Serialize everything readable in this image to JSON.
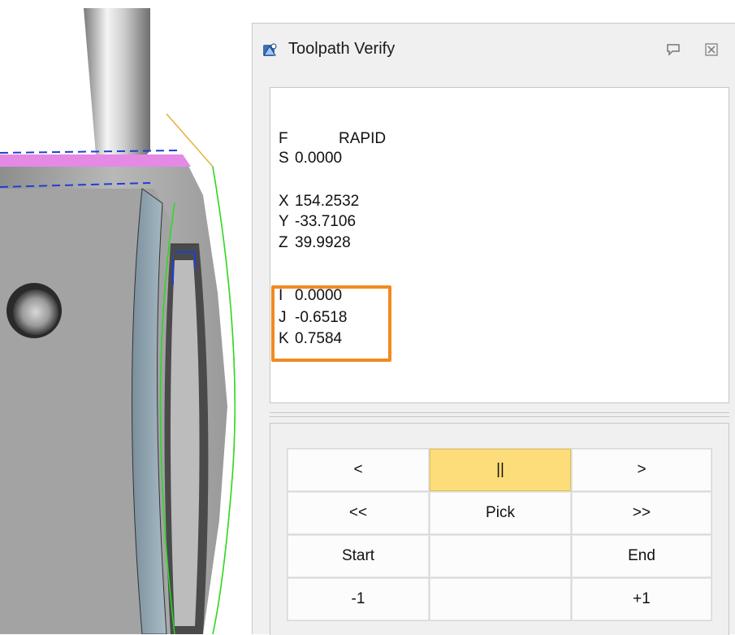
{
  "window": {
    "title": "Toolpath Verify"
  },
  "info": {
    "f_label": "F",
    "f_value": "RAPID",
    "s_label": "S",
    "s_value": "0.0000",
    "x_label": "X",
    "x_value": "154.2532",
    "y_label": "Y",
    "y_value": "-33.7106",
    "z_label": "Z",
    "z_value": "39.9928",
    "i_label": "I",
    "i_value": "0.0000",
    "j_label": "J",
    "j_value": "-0.6518",
    "k_label": "K",
    "k_value": "0.7584"
  },
  "buttons": {
    "prev": "<",
    "pause": "||",
    "next": ">",
    "fast_prev": "<<",
    "pick": "Pick",
    "fast_next": ">>",
    "start": "Start",
    "blank1": "",
    "end": "End",
    "minus_one": "-1",
    "blank2": "",
    "plus_one": "+1"
  },
  "colors": {
    "highlight_box": "#f28a1f",
    "active_button": "#fddd79"
  }
}
